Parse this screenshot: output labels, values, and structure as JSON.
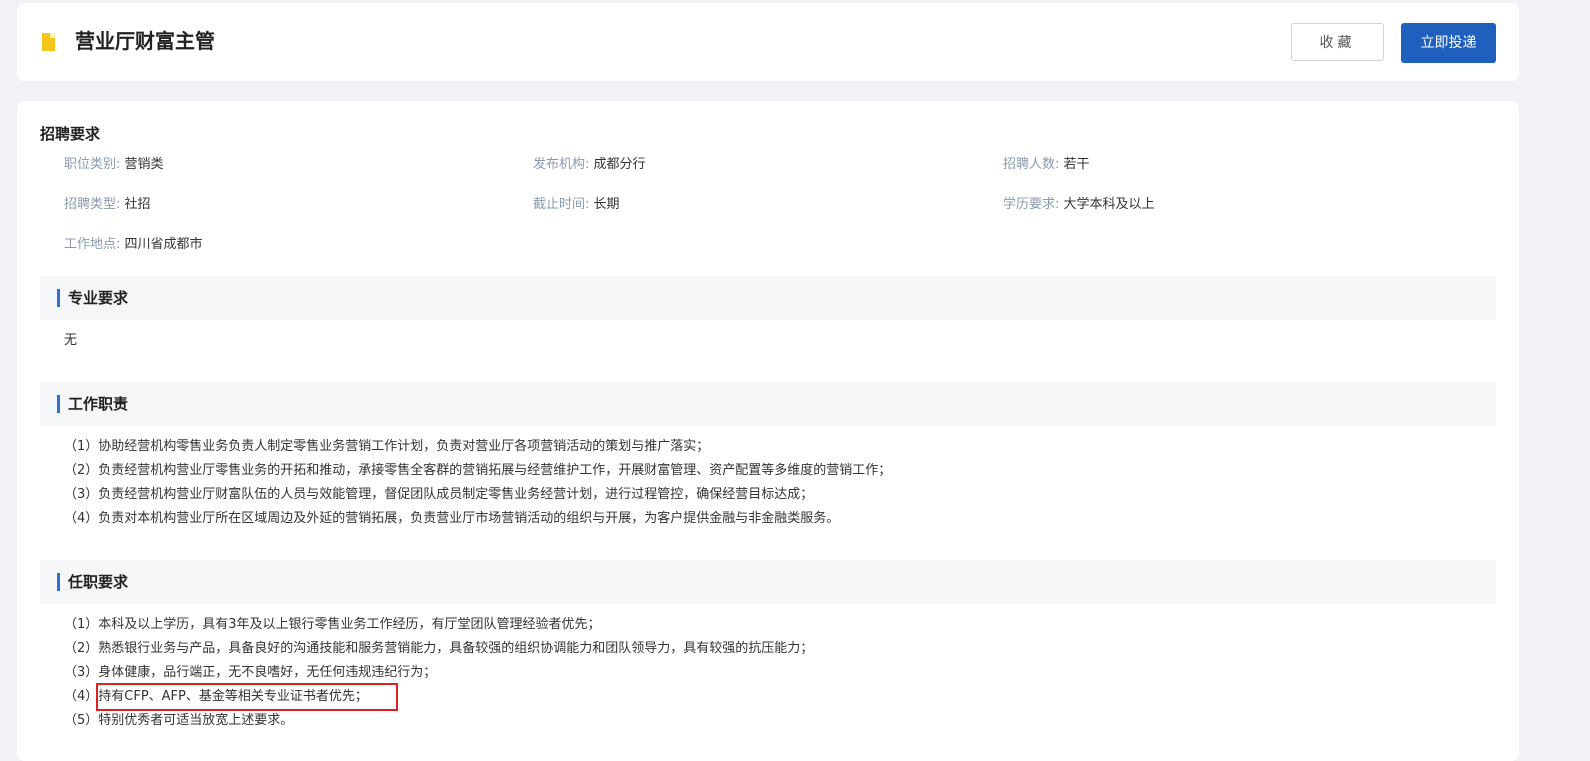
{
  "header": {
    "title": "营业厅财富主管",
    "icon": "bookmark-icon",
    "favorite_label": "收藏",
    "apply_label": "立即投递",
    "accent_color": "#1f5fbe"
  },
  "requirements": {
    "title": "招聘要求",
    "items": [
      {
        "label": "职位类别:",
        "value": "营销类"
      },
      {
        "label": "发布机构:",
        "value": "成都分行"
      },
      {
        "label": "招聘人数:",
        "value": "若干"
      },
      {
        "label": "招聘类型:",
        "value": "社招"
      },
      {
        "label": "截止时间:",
        "value": "长期"
      },
      {
        "label": "学历要求:",
        "value": "大学本科及以上"
      },
      {
        "label": "工作地点:",
        "value": "四川省成都市"
      }
    ]
  },
  "major": {
    "title": "专业要求",
    "content": "无"
  },
  "duties": {
    "title": "工作职责",
    "lines": [
      "（1）协助经营机构零售业务负责人制定零售业务营销工作计划，负责对营业厅各项营销活动的策划与推广落实；",
      "（2）负责经营机构营业厅零售业务的开拓和推动，承接零售全客群的营销拓展与经营维护工作，开展财富管理、资产配置等多维度的营销工作；",
      "（3）负责经营机构营业厅财富队伍的人员与效能管理，督促团队成员制定零售业务经营计划，进行过程管控，确保经营目标达成；",
      "（4）负责对本机构营业厅所在区域周边及外延的营销拓展，负责营业厅市场营销活动的组织与开展，为客户提供金融与非金融类服务。"
    ]
  },
  "qualifications": {
    "title": "任职要求",
    "lines": [
      "（1）本科及以上学历，具有3年及以上银行零售业务工作经历，有厅堂团队管理经验者优先；",
      "（2）熟悉银行业务与产品，具备良好的沟通技能和服务营销能力，具备较强的组织协调能力和团队领导力，具有较强的抗压能力；",
      "（3）身体健康，品行端正，无不良嗜好，无任何违规违纪行为；",
      "（4）持有CFP、AFP、基金等相关专业证书者优先；",
      "（5）特别优秀者可适当放宽上述要求。"
    ]
  }
}
